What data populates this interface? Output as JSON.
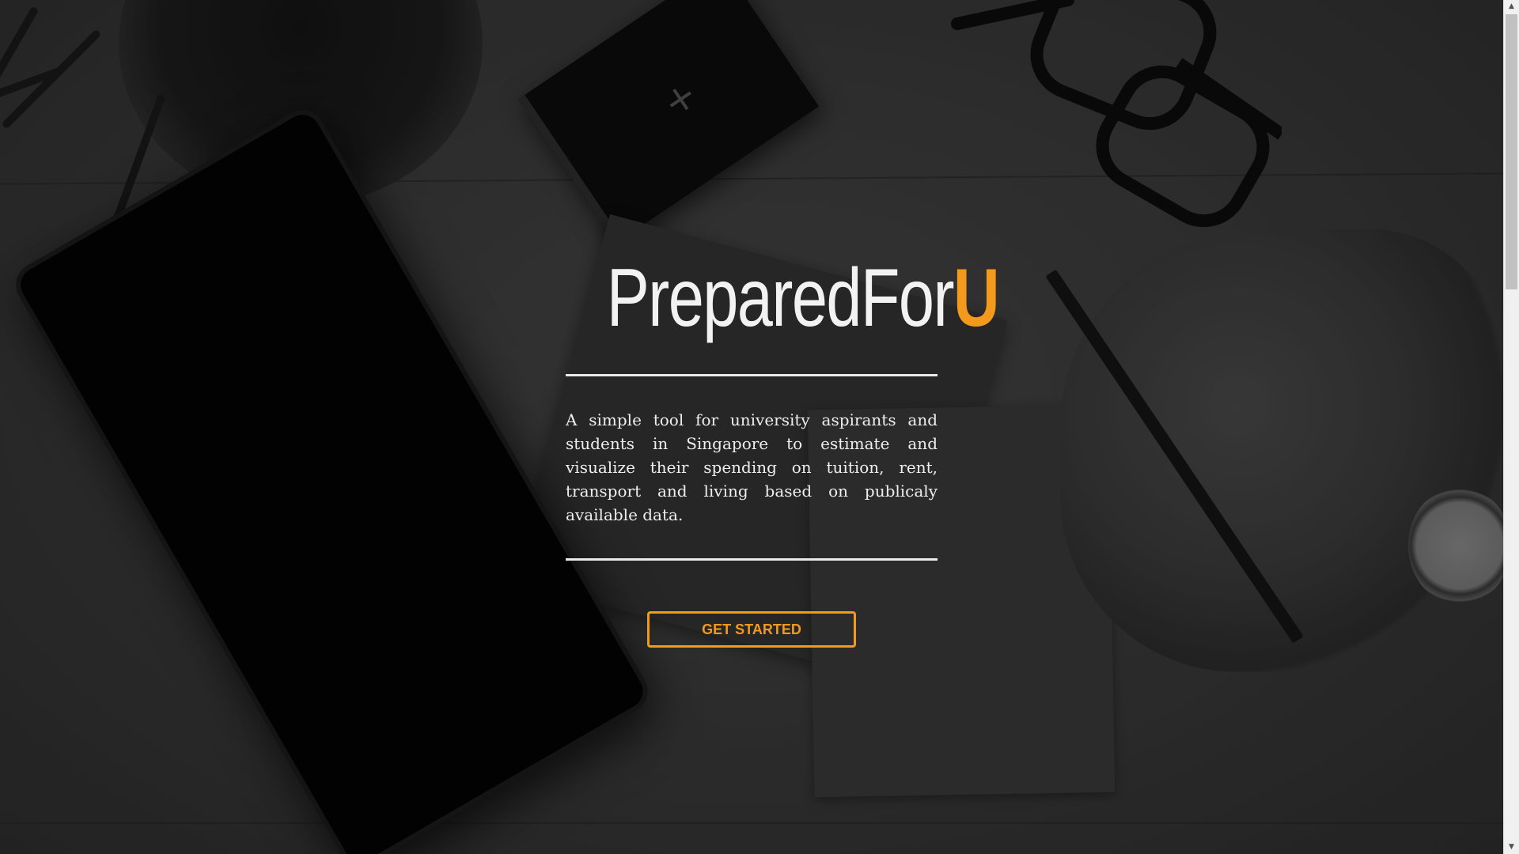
{
  "hero": {
    "title_main": "PreparedFor",
    "title_accent": "U",
    "tagline": "A simple tool for university aspirants and students in Singapore to estimate and visualize their spending on tuition, rent, transport and living based on publicaly available data.",
    "cta_label": "GET STARTED"
  },
  "colors": {
    "accent": "#f39a1c",
    "title": "#f2f2f2",
    "text": "#eeeeee",
    "divider": "#eaeaea",
    "background": "#3a3a3a"
  },
  "scrollbar": {
    "up_icon": "scroll-up-arrow-icon",
    "down_icon": "scroll-down-arrow-icon"
  }
}
